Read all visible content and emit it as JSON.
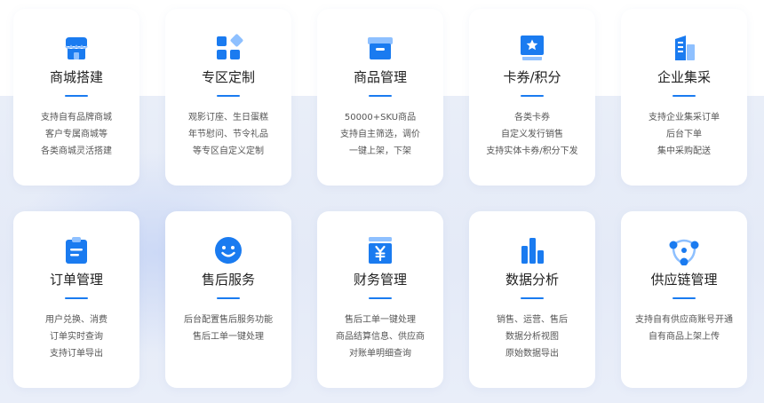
{
  "theme": {
    "accent": "#1a7bf0",
    "icon_light": "#8ec0ff"
  },
  "cards": [
    {
      "icon": "storefront-icon",
      "title": "商城搭建",
      "lines": [
        "支持自有品牌商城",
        "客户专属商城等",
        "各类商城灵活搭建"
      ]
    },
    {
      "icon": "grid-blocks-icon",
      "title": "专区定制",
      "lines": [
        "观影订座、生日蛋糕",
        "年节慰问、节令礼品",
        "等专区自定义定制"
      ]
    },
    {
      "icon": "archive-box-icon",
      "title": "商品管理",
      "lines": [
        "50000+SKU商品",
        "支持自主筛选，调价",
        "一键上架，下架"
      ]
    },
    {
      "icon": "star-coupon-icon",
      "title": "卡券/积分",
      "lines": [
        "各类卡券",
        "自定义发行销售",
        "支持实体卡券/积分下发"
      ]
    },
    {
      "icon": "building-icon",
      "title": "企业集采",
      "lines": [
        "支持企业集采订单",
        "后台下单",
        "集中采购配送"
      ]
    },
    {
      "icon": "clipboard-icon",
      "title": "订单管理",
      "lines": [
        "用户兑换、消费",
        "订单实时查询",
        "支持订单导出"
      ]
    },
    {
      "icon": "smiley-icon",
      "title": "售后服务",
      "lines": [
        "后台配置售后服务功能",
        "售后工单一键处理"
      ]
    },
    {
      "icon": "yen-ledger-icon",
      "title": "财务管理",
      "lines": [
        "售后工单一键处理",
        "商品结算信息、供应商",
        "对账单明细查询"
      ]
    },
    {
      "icon": "bar-chart-icon",
      "title": "数据分析",
      "lines": [
        "销售、运营、售后",
        "数据分析视图",
        "原始数据导出"
      ]
    },
    {
      "icon": "network-nodes-icon",
      "title": "供应链管理",
      "lines": [
        "支持自有供应商账号开通",
        "自有商品上架上传"
      ]
    }
  ]
}
